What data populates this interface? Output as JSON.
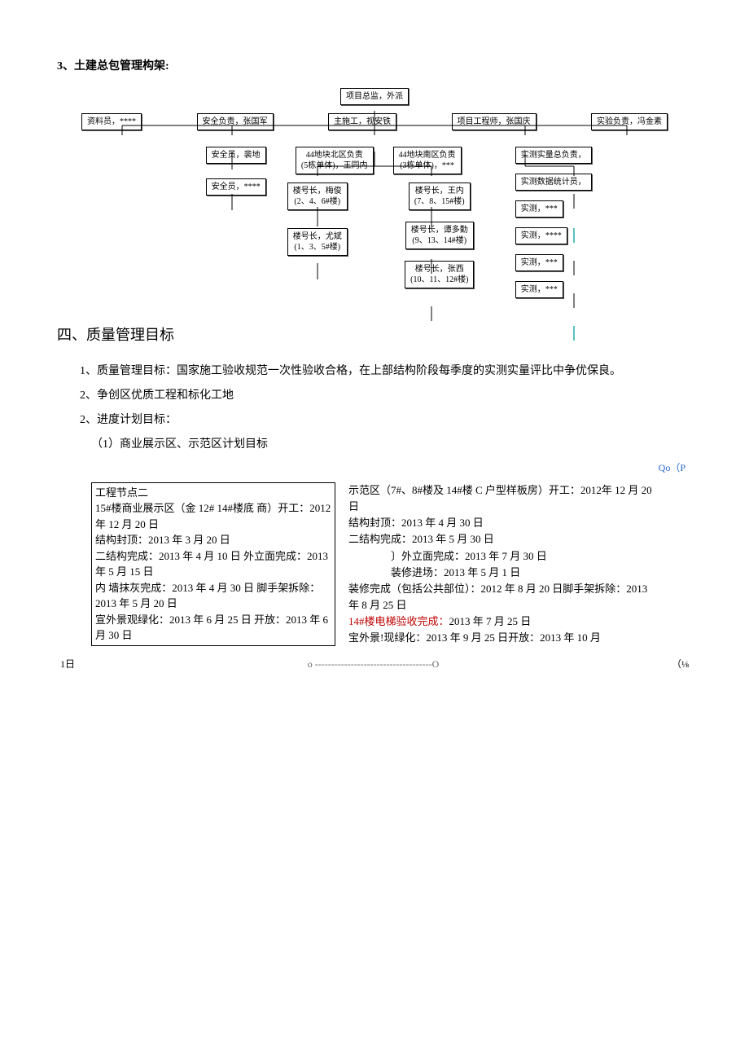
{
  "section3_title": "3、土建总包管理构架:",
  "org": {
    "top": "项目总监，外派",
    "row2": [
      "资料员，****",
      "安全负责，张国军",
      "主施工，视安铁",
      "项目工程师，张国庆",
      "实验负责，冯金素"
    ],
    "left_branch": [
      "安全员，裴地",
      "安全员，****"
    ],
    "center_left": "44地块北区负责\n(5栋单体)，王同内",
    "center_right": "44地块南区负责\n(3栋单体)，***",
    "team_leaders_left": [
      "楼号长，梅俊\n(2、4、6#楼)",
      "楼号长，尤斌\n(1、3、5#楼)"
    ],
    "team_leaders_right": [
      "楼号长，王内\n(7、8、15#楼)",
      "楼号长，谭多勤\n(9、13、14#楼)",
      "楼号长，张西\n(10、11、12#楼)"
    ],
    "right_branch": [
      "实测实量总负责，",
      "实测数据统计员，",
      "实测，***",
      "实测，****",
      "实测，***",
      "实测，***"
    ]
  },
  "section4_title": "四、质量管理目标",
  "para1": "1、质量管理目标：国家施工验收规范一次性验收合格，在上部结构阶段每季度的实测实量评比中争优保良。",
  "para2": "2、争创区优质工程和标化工地",
  "para3": "2、进度计划目标：",
  "para4": "（1）商业展示区、示范区计划目标",
  "qop": "Qo（P",
  "left_box": {
    "title": "工程节点二",
    "lines": [
      "15#楼商业展示区（金 12# 14#楼底 商）开工：2012 年 12 月 20 日",
      "结构封顶：2013 年 3 月 20 日",
      "二结构完成：2013 年 4 月 10 日 外立面完成：2013 年 5 月 15 日",
      "内 墙抹灰完成：2013 年 4 月 30 日 脚手架拆除：2013 年 5 月 20 日",
      "宣外景观绿化：2013 年 6 月 25 日 开放：2013 年 6 月 30 日"
    ]
  },
  "right_box": {
    "lines_a": [
      "示范区（7#、8#楼及 14#楼 C 户型样板房）开工：2012年 12 月 20 日",
      "结构封顶：2013 年 4 月 30 日",
      "二结构完成：2013 年 5 月 30 日"
    ],
    "lines_indent": [
      "〕外立面完成：2013 年 7 月 30 日",
      "装修进场：2013 年 5 月 1 日"
    ],
    "lines_b": [
      "装修完成（包括公共部位）：2012 年 8 月 20 日脚手架拆除：2013 年 8 月 25 日"
    ],
    "red_line": "14#楼电梯验收完成：",
    "red_tail": "2013 年 7 月 25 日",
    "lines_c": [
      "宝外景!现绿化：2013 年 9 月 25 日开放：2013 年 10 月"
    ]
  },
  "footer_left": "1日",
  "footer_mid": "o ------------------------------------O",
  "footer_right": "（⅛"
}
